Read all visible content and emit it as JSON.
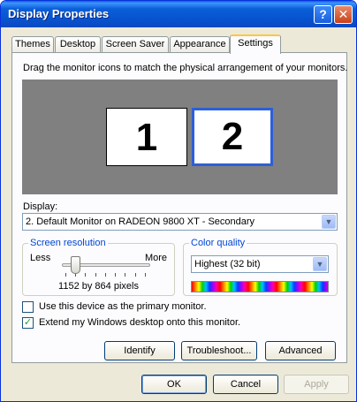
{
  "window": {
    "title": "Display Properties"
  },
  "titlebar": {
    "help_label": "?",
    "close_label": "✕"
  },
  "tabs": [
    {
      "label": "Themes"
    },
    {
      "label": "Desktop"
    },
    {
      "label": "Screen Saver"
    },
    {
      "label": "Appearance"
    },
    {
      "label": "Settings",
      "active": true
    }
  ],
  "settings": {
    "instruction": "Drag the monitor icons to match the physical arrangement of your monitors.",
    "monitors": [
      {
        "label": "1"
      },
      {
        "label": "2",
        "selected": true
      }
    ],
    "display_label": "Display:",
    "display_value": "2. Default Monitor on RADEON 9800 XT - Secondary",
    "resolution": {
      "group_label": "Screen resolution",
      "less_label": "Less",
      "more_label": "More",
      "value_text": "1152 by 864 pixels"
    },
    "color_quality": {
      "group_label": "Color quality",
      "value": "Highest (32 bit)"
    },
    "primary_checkbox": {
      "label": "Use this device as the primary monitor.",
      "checked": false
    },
    "extend_checkbox": {
      "label": "Extend my Windows desktop onto this monitor.",
      "checked": true
    },
    "buttons": {
      "identify": "Identify",
      "troubleshoot": "Troubleshoot...",
      "advanced": "Advanced"
    }
  },
  "dialog_buttons": {
    "ok": "OK",
    "cancel": "Cancel",
    "apply": "Apply"
  },
  "colors": {
    "title_bar": "#0a5fd8",
    "accent_blue": "#0046d5",
    "monitor_area": "#808080",
    "selected_monitor_border": "#2e5fd6"
  }
}
